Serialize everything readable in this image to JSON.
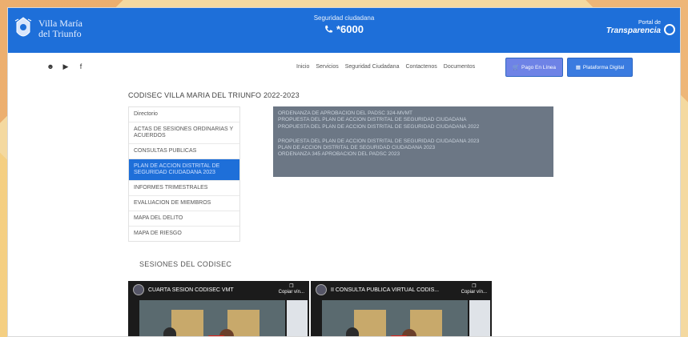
{
  "header": {
    "logo_line1": "Villa María",
    "logo_line2": "del Triunfo",
    "center_label": "Seguridad ciudadana",
    "phone": "*6000",
    "portal_line1": "Portal de",
    "portal_line2": "Transparencia"
  },
  "social": {
    "icons": [
      "user-icon",
      "youtube-icon",
      "facebook-icon"
    ]
  },
  "menu": {
    "items": [
      "Inicio",
      "Servicios",
      "Seguridad Ciudadana",
      "Contactenos",
      "Documentos"
    ],
    "pago_label": "Pago En Línea",
    "digital_label": "Plataforma Digital"
  },
  "page_title": "CODISEC VILLA MARIA DEL TRIUNFO 2022-2023",
  "sidebar": {
    "items": [
      "Directorio",
      "ACTAS DE SESIONES ORDINARIAS Y ACUERDOS",
      "CONSULTAS PUBLICAS",
      "PLAN DE ACCION DISTRITAL DE SEGURIDAD CIUDADANA 2023",
      "INFORMES TRIMESTRALES",
      "EVALUACION DE MIEMBROS",
      "MAPA DEL DELITO",
      "MAPA DE RIESGO"
    ],
    "active_index": 3
  },
  "documents": {
    "group1": [
      "ORDENANZA DE APROBACION DEL PADSC 324-MVMT",
      "PROPUESTA DEL PLAN DE ACCION DISTRITAL DE SEGURIDAD CIUDADANA",
      "PROPUESTA DEL PLAN DE ACCION DISTRITAL DE SEGURIDAD CIUDADANA 2022"
    ],
    "group2": [
      "PROPUESTA DEL PLAN DE ACCION DISTRITAL DE SEGURIDAD CIUDADANA 2023",
      "PLAN DE ACCION DISTRITAL DE SEGURIDAD CIUDADANA 2023",
      "ORDENANZA 345 APROBACION DEL PADSC 2023"
    ]
  },
  "sesiones": {
    "title": "SESIONES DEL CODISEC",
    "videos": [
      {
        "title": "CUARTA SESION CODISEC VMT",
        "copy_label": "Copiar vín..."
      },
      {
        "title": "II CONSULTA PÚBLICA VIRTUAL CODIS...",
        "copy_label": "Copiar vín..."
      }
    ]
  },
  "colors": {
    "header_blue": "#1e6fd9",
    "sidebar_active": "#1e6fd9",
    "documents_panel": "#6c7785"
  }
}
